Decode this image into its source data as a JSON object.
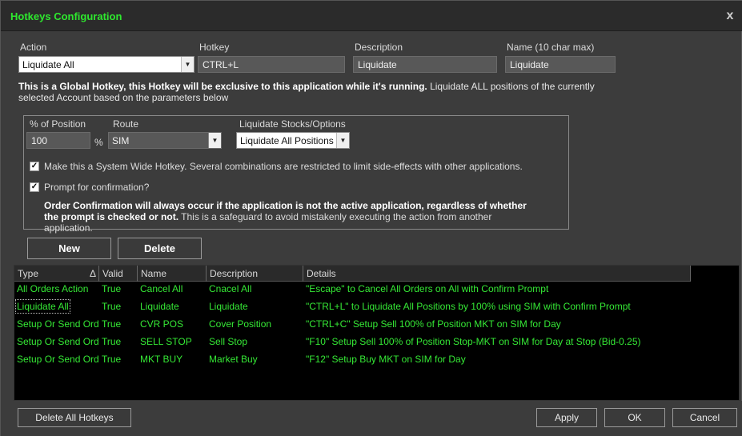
{
  "window": {
    "title": "Hotkeys Configuration",
    "close": "x"
  },
  "form": {
    "action_label": "Action",
    "action_value": "Liquidate All",
    "hotkey_label": "Hotkey",
    "hotkey_value": "CTRL+L",
    "description_label": "Description",
    "description_value": "Liquidate",
    "name_label": "Name (10 char max)",
    "name_value": "Liquidate"
  },
  "note": {
    "bold": "This is a Global Hotkey, this Hotkey will be exclusive to this application while it's running.",
    "text": " Liquidate ALL positions of the currently selected Account based on the parameters below"
  },
  "params": {
    "percent_label": "% of Position",
    "percent_value": "100",
    "percent_unit": "%",
    "route_label": "Route",
    "route_value": "SIM",
    "liquidate_label": "Liquidate Stocks/Options",
    "liquidate_value": "Liquidate All Positions",
    "system_wide_checked": true,
    "system_wide_label": "Make this a System Wide Hotkey. Several combinations are restricted to limit side-effects with other applications.",
    "prompt_checked": true,
    "prompt_label": "Prompt for confirmation?",
    "confirm_bold": "Order Confirmation will always occur if the application is not the active application, regardless of whether the prompt is checked or not.",
    "confirm_text": " This is a safeguard to avoid mistakenly executing the action from another application."
  },
  "buttons": {
    "new": "New",
    "delete": "Delete",
    "delete_all": "Delete All Hotkeys",
    "apply": "Apply",
    "ok": "OK",
    "cancel": "Cancel"
  },
  "grid": {
    "columns": [
      "Type",
      "Valid",
      "Name",
      "Description",
      "Details"
    ],
    "sort_indicator": "Δ",
    "rows": [
      {
        "type": "All Orders Action",
        "valid": "True",
        "name": "Cancel All",
        "description": "Cnacel All",
        "details": "\"Escape\" to Cancel All Orders on All with Confirm Prompt"
      },
      {
        "type": "Liquidate All",
        "valid": "True",
        "name": "Liquidate",
        "description": "Liquidate",
        "details": "\"CTRL+L\" to Liquidate All Positions by 100% using SIM with Confirm Prompt"
      },
      {
        "type": "Setup Or Send Ord",
        "valid": "True",
        "name": "CVR POS",
        "description": "Cover Position",
        "details": "\"CTRL+C\" Setup Sell 100% of Position MKT on SIM for Day"
      },
      {
        "type": "Setup Or Send Ord",
        "valid": "True",
        "name": "SELL STOP",
        "description": "Sell Stop",
        "details": "\"F10\" Setup Sell 100% of Position Stop-MKT on SIM for Day at Stop (Bid-0.25)"
      },
      {
        "type": "Setup Or Send Ord",
        "valid": "True",
        "name": "MKT BUY",
        "description": "Market Buy",
        "details": "\"F12\" Setup Buy MKT on SIM for Day"
      }
    ]
  }
}
